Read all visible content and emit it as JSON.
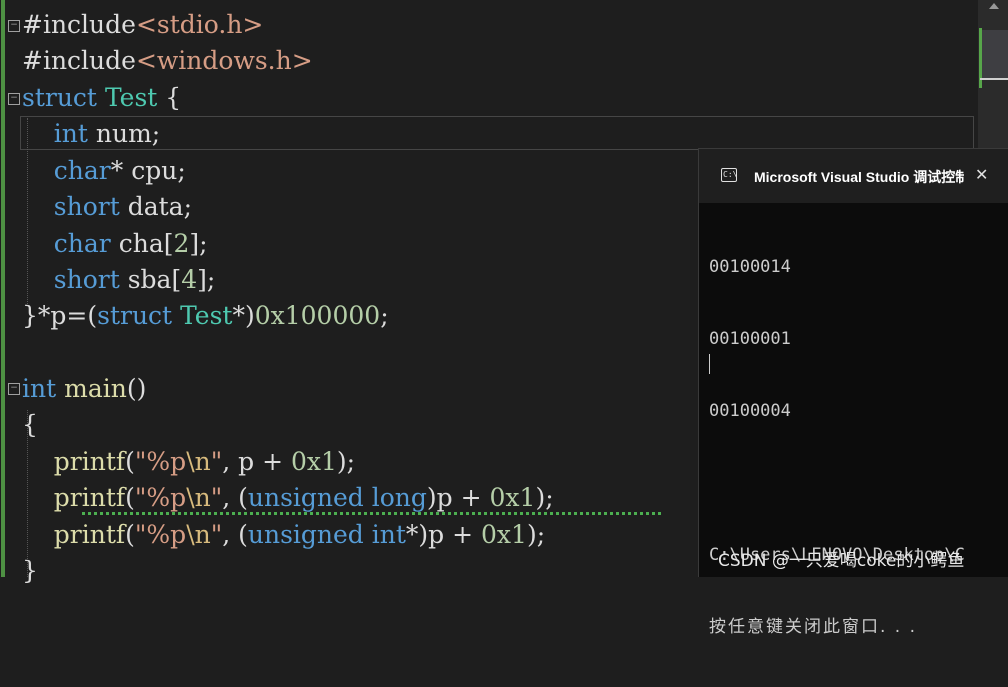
{
  "editor": {
    "lines": [
      {
        "id": "l1",
        "parts": [
          {
            "t": "#include",
            "c": ""
          },
          {
            "t": "<stdio.h>",
            "c": "str"
          }
        ]
      },
      {
        "id": "l2",
        "parts": [
          {
            "t": "#include",
            "c": ""
          },
          {
            "t": "<windows.h>",
            "c": "str"
          }
        ]
      },
      {
        "id": "l3",
        "parts": [
          {
            "t": "struct",
            "c": "kw"
          },
          {
            "t": " ",
            "c": ""
          },
          {
            "t": "Test",
            "c": "type"
          },
          {
            "t": " {",
            "c": ""
          }
        ]
      },
      {
        "id": "l4",
        "parts": [
          {
            "t": "    ",
            "c": ""
          },
          {
            "t": "int",
            "c": "kw"
          },
          {
            "t": " num;",
            "c": ""
          }
        ]
      },
      {
        "id": "l5",
        "parts": [
          {
            "t": "    ",
            "c": ""
          },
          {
            "t": "char",
            "c": "kw"
          },
          {
            "t": "* cpu;",
            "c": ""
          }
        ]
      },
      {
        "id": "l6",
        "parts": [
          {
            "t": "    ",
            "c": ""
          },
          {
            "t": "short",
            "c": "kw"
          },
          {
            "t": " data;",
            "c": ""
          }
        ]
      },
      {
        "id": "l7",
        "parts": [
          {
            "t": "    ",
            "c": ""
          },
          {
            "t": "char",
            "c": "kw"
          },
          {
            "t": " cha[",
            "c": ""
          },
          {
            "t": "2",
            "c": "num"
          },
          {
            "t": "];",
            "c": ""
          }
        ]
      },
      {
        "id": "l8",
        "parts": [
          {
            "t": "    ",
            "c": ""
          },
          {
            "t": "short",
            "c": "kw"
          },
          {
            "t": " sba[",
            "c": ""
          },
          {
            "t": "4",
            "c": "num"
          },
          {
            "t": "];",
            "c": ""
          }
        ]
      },
      {
        "id": "l9",
        "parts": [
          {
            "t": "}*p=(",
            "c": ""
          },
          {
            "t": "struct",
            "c": "kw"
          },
          {
            "t": " ",
            "c": ""
          },
          {
            "t": "Test",
            "c": "type"
          },
          {
            "t": "*)",
            "c": ""
          },
          {
            "t": "0x100000",
            "c": "num"
          },
          {
            "t": ";",
            "c": ""
          }
        ]
      },
      {
        "id": "l10",
        "parts": [
          {
            "t": "",
            "c": ""
          }
        ]
      },
      {
        "id": "l11",
        "parts": [
          {
            "t": "int",
            "c": "kw"
          },
          {
            "t": " ",
            "c": ""
          },
          {
            "t": "main",
            "c": "fn"
          },
          {
            "t": "()",
            "c": ""
          }
        ]
      },
      {
        "id": "l12",
        "parts": [
          {
            "t": "{",
            "c": ""
          }
        ]
      },
      {
        "id": "l13",
        "parts": [
          {
            "t": "    ",
            "c": ""
          },
          {
            "t": "printf",
            "c": "fn"
          },
          {
            "t": "(",
            "c": ""
          },
          {
            "t": "\"%p",
            "c": "str"
          },
          {
            "t": "\\n",
            "c": "esc"
          },
          {
            "t": "\"",
            "c": "str"
          },
          {
            "t": ", p + ",
            "c": ""
          },
          {
            "t": "0x1",
            "c": "num"
          },
          {
            "t": ");",
            "c": ""
          }
        ]
      },
      {
        "id": "l14",
        "parts": [
          {
            "t": "    ",
            "c": ""
          },
          {
            "t": "printf",
            "c": "fn"
          },
          {
            "t": "(",
            "c": ""
          },
          {
            "t": "\"%p",
            "c": "str"
          },
          {
            "t": "\\n",
            "c": "esc"
          },
          {
            "t": "\"",
            "c": "str"
          },
          {
            "t": ", (",
            "c": ""
          },
          {
            "t": "unsigned long",
            "c": "kw"
          },
          {
            "t": ")p + ",
            "c": ""
          },
          {
            "t": "0x1",
            "c": "num"
          },
          {
            "t": ");",
            "c": ""
          }
        ]
      },
      {
        "id": "l15",
        "parts": [
          {
            "t": "    ",
            "c": ""
          },
          {
            "t": "printf",
            "c": "fn"
          },
          {
            "t": "(",
            "c": ""
          },
          {
            "t": "\"%p",
            "c": "str"
          },
          {
            "t": "\\n",
            "c": "esc"
          },
          {
            "t": "\"",
            "c": "str"
          },
          {
            "t": ", (",
            "c": ""
          },
          {
            "t": "unsigned int",
            "c": "kw"
          },
          {
            "t": "*)p + ",
            "c": ""
          },
          {
            "t": "0x1",
            "c": "num"
          },
          {
            "t": ");",
            "c": ""
          }
        ]
      },
      {
        "id": "l16",
        "parts": [
          {
            "t": "}",
            "c": ""
          }
        ]
      }
    ]
  },
  "console": {
    "title": "Microsoft Visual Studio 调试控制台",
    "icon": "console-window-icon",
    "close_icon": "close-icon",
    "output": [
      "00100014",
      "00100001",
      "00100004",
      "",
      "C:\\Users\\LENOVO\\Desktop\\C"
    ],
    "prompt": "按任意键关闭此窗口. . ."
  },
  "watermark": "CSDN @一只爱喝coke的小鳄鱼",
  "colors": {
    "keyword": "#569cd6",
    "type": "#4ec9b0",
    "string": "#d69d85",
    "number": "#b5cea8",
    "function": "#dcdcaa",
    "background": "#1e1e1e"
  }
}
